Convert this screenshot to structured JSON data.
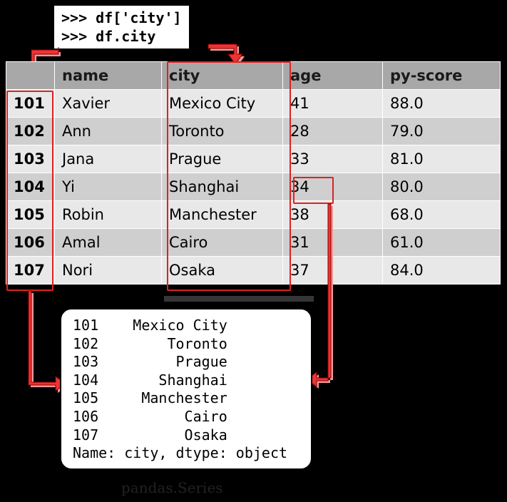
{
  "code": {
    "line1": ">>> df['city']",
    "line2": ">>> df.city"
  },
  "table": {
    "headers": {
      "idx": "",
      "name": "name",
      "city": "city",
      "age": "age",
      "pyscore": "py-score"
    },
    "rows": [
      {
        "idx": "101",
        "name": "Xavier",
        "city": "Mexico City",
        "age": "41",
        "pyscore": "88.0"
      },
      {
        "idx": "102",
        "name": "Ann",
        "city": "Toronto",
        "age": "28",
        "pyscore": "79.0"
      },
      {
        "idx": "103",
        "name": "Jana",
        "city": "Prague",
        "age": "33",
        "pyscore": "81.0"
      },
      {
        "idx": "104",
        "name": "Yi",
        "city": "Shanghai",
        "age": "34",
        "pyscore": "80.0"
      },
      {
        "idx": "105",
        "name": "Robin",
        "city": "Manchester",
        "age": "38",
        "pyscore": "68.0"
      },
      {
        "idx": "106",
        "name": "Amal",
        "city": "Cairo",
        "age": "31",
        "pyscore": "61.0"
      },
      {
        "idx": "107",
        "name": "Nori",
        "city": "Osaka",
        "age": "37",
        "pyscore": "84.0"
      }
    ]
  },
  "series": {
    "lines": [
      "101    Mexico City",
      "102        Toronto",
      "103         Prague",
      "104       Shanghai",
      "105     Manchester",
      "106          Cairo",
      "107          Osaka",
      "Name: city, dtype: object"
    ],
    "caption": "pandas.Series"
  }
}
